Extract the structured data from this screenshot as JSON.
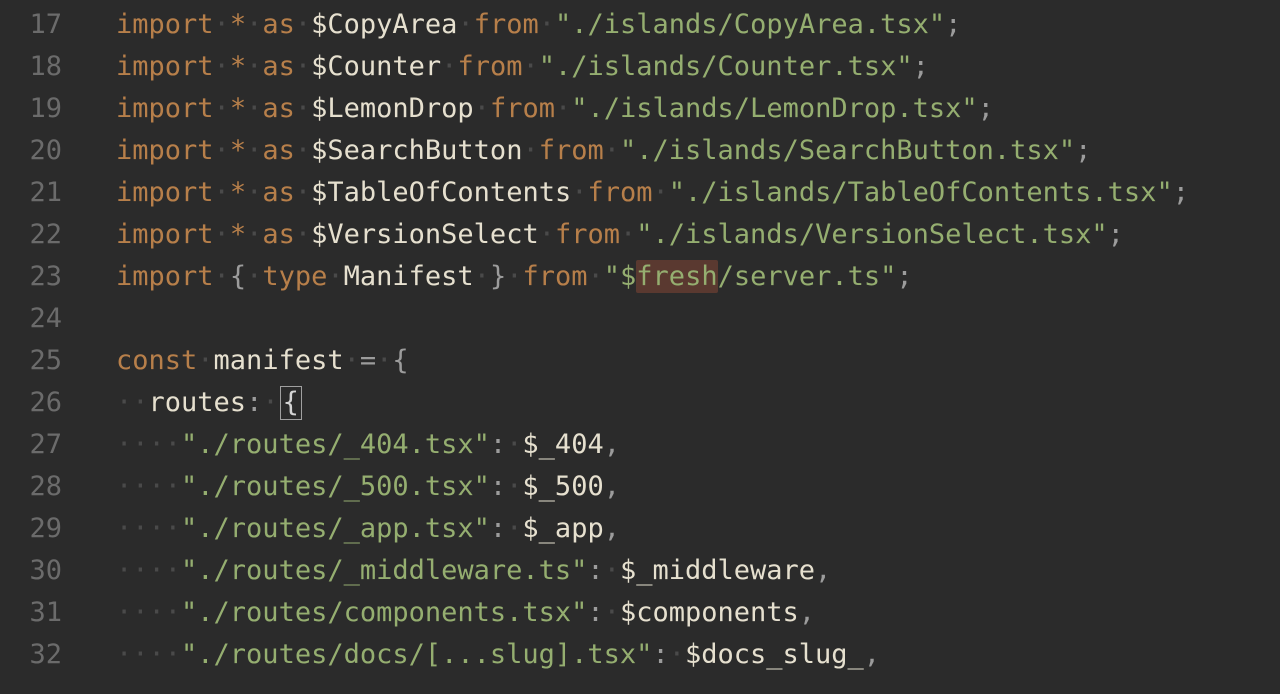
{
  "lines": [
    {
      "num": 17,
      "indent": 0,
      "type": "import-star",
      "alias": "$CopyArea",
      "path": "\"./islands/CopyArea.tsx\""
    },
    {
      "num": 18,
      "indent": 0,
      "type": "import-star",
      "alias": "$Counter",
      "path": "\"./islands/Counter.tsx\""
    },
    {
      "num": 19,
      "indent": 0,
      "type": "import-star",
      "alias": "$LemonDrop",
      "path": "\"./islands/LemonDrop.tsx\""
    },
    {
      "num": 20,
      "indent": 0,
      "type": "import-star",
      "alias": "$SearchButton",
      "path": "\"./islands/SearchButton.tsx\""
    },
    {
      "num": 21,
      "indent": 0,
      "type": "import-star",
      "alias": "$TableOfContents",
      "path": "\"./islands/TableOfContents.tsx\""
    },
    {
      "num": 22,
      "indent": 0,
      "type": "import-star",
      "alias": "$VersionSelect",
      "path": "\"./islands/VersionSelect.tsx\""
    },
    {
      "num": 23,
      "indent": 0,
      "type": "import-type",
      "typeName": "Manifest",
      "path_before": "\"$",
      "path_hl": "fresh",
      "path_after": "/server.ts\""
    },
    {
      "num": 24,
      "indent": 0,
      "type": "blank"
    },
    {
      "num": 25,
      "indent": 0,
      "type": "const-open",
      "kw": "const",
      "name": "manifest",
      "op": "=",
      "brace": "{"
    },
    {
      "num": 26,
      "indent": 1,
      "type": "prop-open-cursor",
      "key": "routes",
      "brace": "{"
    },
    {
      "num": 27,
      "indent": 2,
      "type": "route",
      "key": "\"./routes/_404.tsx\"",
      "val": "$_404"
    },
    {
      "num": 28,
      "indent": 2,
      "type": "route",
      "key": "\"./routes/_500.tsx\"",
      "val": "$_500"
    },
    {
      "num": 29,
      "indent": 2,
      "type": "route",
      "key": "\"./routes/_app.tsx\"",
      "val": "$_app"
    },
    {
      "num": 30,
      "indent": 2,
      "type": "route",
      "key": "\"./routes/_middleware.ts\"",
      "val": "$_middleware"
    },
    {
      "num": 31,
      "indent": 2,
      "type": "route",
      "key": "\"./routes/components.tsx\"",
      "val": "$components"
    },
    {
      "num": 32,
      "indent": 2,
      "type": "route",
      "key": "\"./routes/docs/[...slug].tsx\"",
      "val": "$docs_slug_"
    }
  ],
  "tokens": {
    "import": "import",
    "star": "*",
    "as": "as",
    "from": "from",
    "type": "type",
    "const": "const",
    "semi": ";",
    "comma": ",",
    "colon": ":",
    "eq": "=",
    "lbrace": "{",
    "rbrace": "}",
    "ws_dot": "·"
  }
}
